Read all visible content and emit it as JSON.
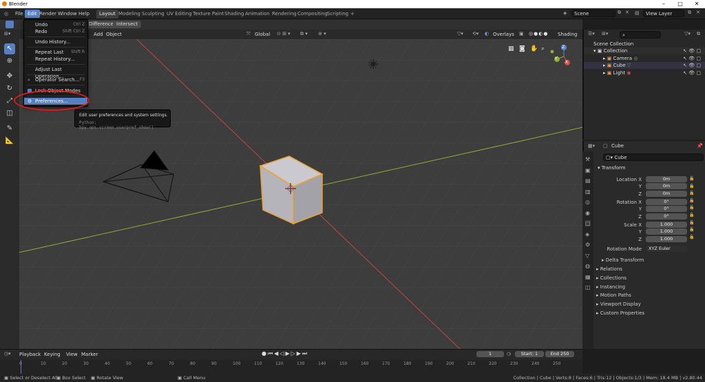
{
  "window": {
    "title": "Blender",
    "controls": [
      "–",
      "□",
      "✕"
    ]
  },
  "menubar": {
    "items": [
      "File",
      "Edit",
      "Render",
      "Window",
      "Help"
    ]
  },
  "workspaces": {
    "tabs": [
      "Layout",
      "Modeling",
      "Sculpting",
      "UV Editing",
      "Texture Paint",
      "Shading",
      "Animation",
      "Rendering",
      "Compositing",
      "Scripting"
    ],
    "add": "+"
  },
  "scene": {
    "scene_label": "Scene",
    "view_layer_label": "View Layer"
  },
  "toolbar": {
    "difference": "Difference",
    "intersect": "Intersect"
  },
  "viewport_header": {
    "add": "Add",
    "object": "Object",
    "orientation": "Global",
    "overlays": "Overlays",
    "shading": "Shading"
  },
  "edit_menu": {
    "undo": "Undo",
    "undo_sc": "Ctrl Z",
    "redo": "Redo",
    "redo_sc": "Shift Ctrl Z",
    "undo_history": "Undo History...",
    "repeat_last": "Repeat Last",
    "repeat_last_sc": "Shift R",
    "repeat_history": "Repeat History...",
    "adjust_last": "Adjust Last Operation...",
    "operator_search": "Operator Search...",
    "operator_search_sc": "F3",
    "lock_modes": "Lock Object Modes",
    "preferences": "Preferences..."
  },
  "tooltip": {
    "text": "Edit user preferences and system settings.",
    "python": "Python: bpy.ops.screen.userpref_show()"
  },
  "outliner": {
    "scene_collection": "Scene Collection",
    "collection": "Collection",
    "items": [
      "Camera",
      "Cube",
      "Light"
    ]
  },
  "properties": {
    "object_name": "Cube",
    "datablock": "Cube",
    "transform": "Transform",
    "location_label": "Location X",
    "rotation_label": "Rotation X",
    "scale_label": "Scale X",
    "y": "Y",
    "z": "Z",
    "location": [
      "0m",
      "0m",
      "0m"
    ],
    "rotation": [
      "0°",
      "0°",
      "0°"
    ],
    "scale": [
      "1.000",
      "1.000",
      "1.000"
    ],
    "rotation_mode_label": "Rotation Mode",
    "rotation_mode": "XYZ Euler",
    "delta": "Delta Transform",
    "subpanels": [
      "Relations",
      "Collections",
      "Instancing",
      "Motion Paths",
      "Viewport Display",
      "Custom Properties"
    ]
  },
  "timeline": {
    "menu": [
      "Playback",
      "Keying",
      "View",
      "Marker"
    ],
    "current": "1",
    "start_label": "Start:",
    "start": "1",
    "end_label": "End",
    "end": "250",
    "ticks": [
      "0",
      "10",
      "20",
      "30",
      "40",
      "50",
      "60",
      "70",
      "80",
      "90",
      "100",
      "110",
      "120",
      "130",
      "140",
      "150",
      "160",
      "170",
      "180",
      "190",
      "200",
      "210",
      "220",
      "230",
      "240",
      "250"
    ]
  },
  "status": {
    "select": "Select or Deselect All",
    "box": "Box Select",
    "rotate": "Rotate View",
    "call_menu": "Call Menu",
    "info": "Collection | Cube | Verts:8 | Faces:6 | Tris:12 | Objects:1/3 | Mem: 18.4 MB | v2.80.44"
  },
  "gizmo": {
    "x": "X",
    "y": "Y",
    "z": "Z"
  },
  "colors": {
    "accent": "#5680c2",
    "highlight_circle": "#e01a1a",
    "object_outline": "#f0a030",
    "x_axis": "#d94a4a",
    "y_axis": "#8fad35"
  }
}
